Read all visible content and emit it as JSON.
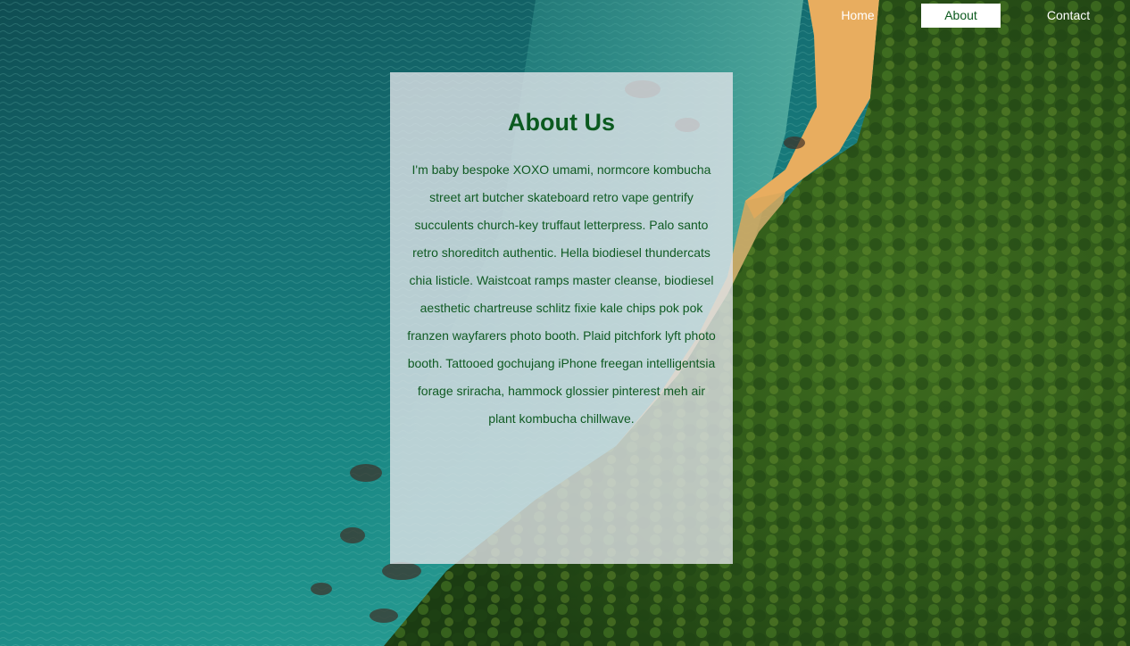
{
  "nav": {
    "items": [
      {
        "label": "Home",
        "active": false
      },
      {
        "label": "About",
        "active": true
      },
      {
        "label": "Contact",
        "active": false
      }
    ]
  },
  "about": {
    "title": "About Us",
    "body": "I'm baby bespoke XOXO umami, normcore kombucha street art butcher skateboard retro vape gentrify succulents church-key truffaut letterpress. Palo santo retro shoreditch authentic. Hella biodiesel thundercats chia listicle. Waistcoat ramps master cleanse, biodiesel aesthetic chartreuse schlitz fixie kale chips pok pok franzen wayfarers photo booth. Plaid pitchfork lyft photo booth. Tattooed gochujang iPhone freegan intelligentsia forage sriracha, hammock glossier pinterest meh air plant kombucha chillwave."
  },
  "colors": {
    "accent_green": "#0b5a1f",
    "nav_text": "#ffffff",
    "card_background": "rgba(225,228,232,0.80)"
  }
}
